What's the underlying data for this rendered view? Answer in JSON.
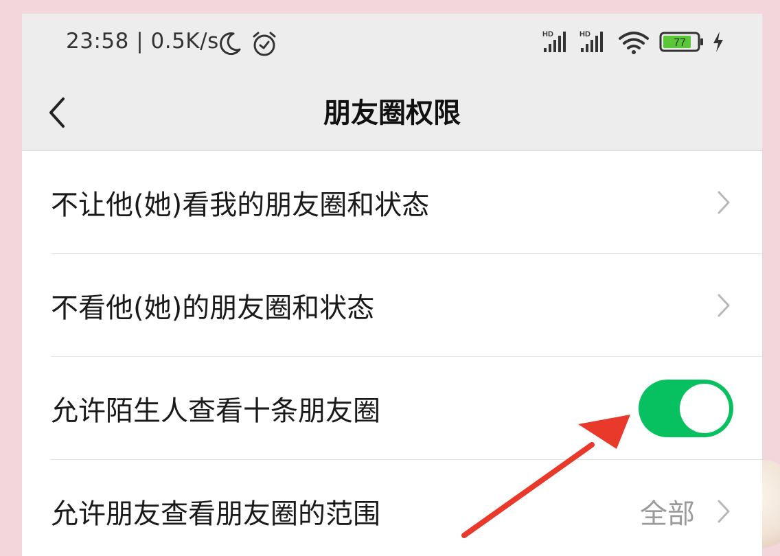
{
  "status_bar": {
    "time_speed": "23:58 | 0.5K/s",
    "signal_1_label": "HD",
    "signal_2_label": "HD",
    "battery_level": "77",
    "icons": [
      "moon-icon",
      "alarm-icon",
      "signal-icon",
      "wifi-icon",
      "battery-icon",
      "charging-icon"
    ]
  },
  "nav": {
    "title": "朋友圈权限",
    "back_icon": "chevron-left-icon"
  },
  "settings": {
    "items": [
      {
        "label": "不让他(她)看我的朋友圈和状态",
        "control": "chevron"
      },
      {
        "label": "不看他(她)的朋友圈和状态",
        "control": "chevron"
      },
      {
        "label": "允许陌生人查看十条朋友圈",
        "control": "toggle",
        "toggle_on": true
      },
      {
        "label": "允许朋友查看朋友圈的范围",
        "value": "全部",
        "control": "chevron"
      }
    ]
  },
  "colors": {
    "toggle_on": "#07c160",
    "annotation_arrow": "#e8392b",
    "header_bg": "#ededed",
    "page_bg": "#f2d6db"
  }
}
